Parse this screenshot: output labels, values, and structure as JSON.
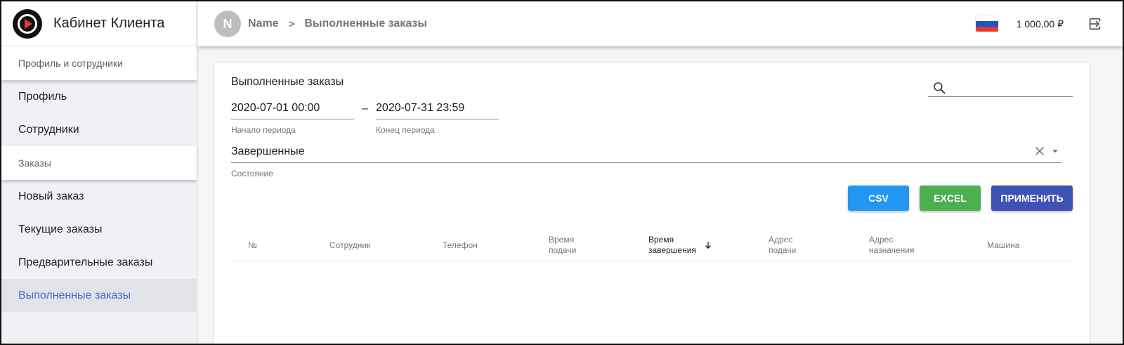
{
  "brand": {
    "title": "Кабинет Клиента"
  },
  "sidebar": {
    "sections": [
      {
        "header": "Профиль и сотрудники",
        "items": [
          "Профиль",
          "Сотрудники"
        ]
      },
      {
        "header": "Заказы",
        "items": [
          "Новый заказ",
          "Текущие заказы",
          "Предварительные заказы",
          "Выполненные заказы"
        ]
      }
    ],
    "active_item": "Выполненные заказы"
  },
  "topbar": {
    "avatar_initial": "N",
    "user_name": "Name",
    "separator": ">",
    "page": "Выполненные заказы",
    "flag_icon": "russia-flag-icon",
    "balance": "1 000,00 ₽",
    "logout_icon": "logout-icon"
  },
  "card": {
    "title": "Выполненные заказы",
    "search": {
      "value": "",
      "placeholder": ""
    },
    "period_start": {
      "value": "2020-07-01 00:00",
      "label": "Начало периода"
    },
    "period_dash": "–",
    "period_end": {
      "value": "2020-07-31 23:59",
      "label": "Конец периода"
    },
    "state": {
      "value": "Завершенные",
      "label": "Состояние"
    },
    "buttons": {
      "csv": "CSV",
      "excel": "EXCEL",
      "apply": "ПРИМЕНИТЬ"
    },
    "table": {
      "columns": [
        "№",
        "Сотрудник",
        "Телефон",
        "Время подачи",
        "Время завершения",
        "Адрес подачи",
        "Адрес назначения",
        "Машина"
      ],
      "sorted_column": "Время завершения",
      "rows": []
    }
  },
  "colors": {
    "csv": "#2196f3",
    "excel": "#4caf50",
    "apply": "#3f51b5",
    "active_nav": "#3f6fcf"
  }
}
